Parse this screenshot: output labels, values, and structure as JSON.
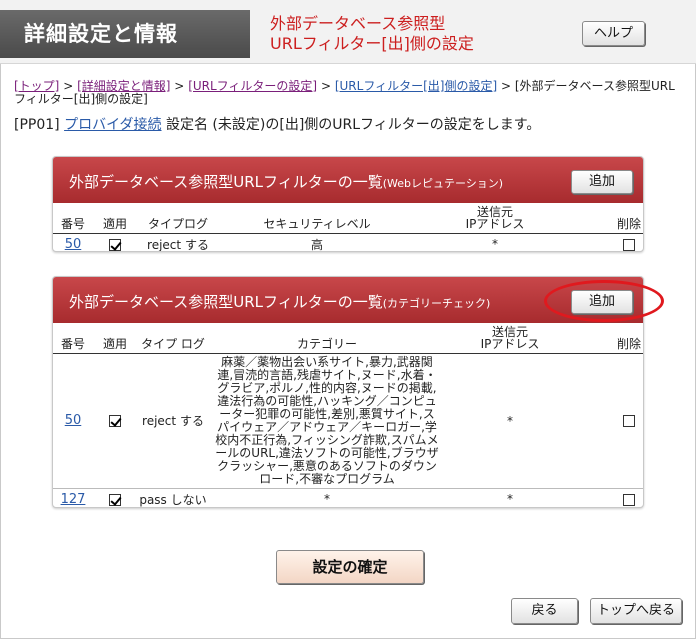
{
  "header": {
    "title": "詳細設定と情報",
    "subtitle_line1": "外部データベース参照型",
    "subtitle_line2": "URLフィルター[出]側の設定",
    "help_label": "ヘルプ"
  },
  "breadcrumb": {
    "items": [
      "[トップ]",
      "[詳細設定と情報]",
      "[URLフィルターの設定]",
      "[URLフィルター[出]側の設定]"
    ],
    "separator": ">",
    "current": "[外部データベース参照型URLフィルター[出]側の設定]"
  },
  "intro": {
    "prefix": "[PP01]",
    "provider_link": "プロバイダ接続",
    "text": "設定名 (未設定)の[出]側のURLフィルターの設定をします。"
  },
  "panel1": {
    "title_main": "外部データベース参照型URLフィルターの一覧",
    "title_small": "(Webレピュテーション)",
    "add_label": "追加",
    "columns": [
      "番号",
      "適用",
      "タイプ",
      "ログ",
      "セキュリティレベル",
      "送信元",
      "IPアドレス",
      "削除"
    ],
    "rows": [
      {
        "number": "50",
        "applied": true,
        "type": "reject",
        "log": "する",
        "level": "高",
        "ip": "*",
        "delete": false
      }
    ]
  },
  "panel2": {
    "title_main": "外部データベース参照型URLフィルターの一覧",
    "title_small": "(カテゴリーチェック)",
    "add_label": "追加",
    "columns": [
      "番号",
      "適用",
      "タイプ",
      "ログ",
      "カテゴリー",
      "送信元",
      "IPアドレス",
      "削除"
    ],
    "rows": [
      {
        "number": "50",
        "applied": true,
        "type": "reject",
        "log": "する",
        "category": "麻薬／薬物出会い系サイト,暴力,武器関連,冒涜的言語,残虐サイト,ヌード,水着・グラビア,ポルノ,性的内容,ヌードの掲載,違法行為の可能性,ハッキング／コンピューター犯罪の可能性,差別,悪質サイト,スパイウェア／アドウェア／キーロガー,学校内不正行為,フィッシング詐欺,スパムメールのURL,違法ソフトの可能性,ブラウザクラッシャー,悪意のあるソフトのダウンロード,不審なプログラム",
        "ip": "*",
        "delete": false
      },
      {
        "number": "127",
        "applied": true,
        "type": "pass",
        "log": "しない",
        "category": "*",
        "ip": "*",
        "delete": false
      }
    ]
  },
  "footer": {
    "confirm_label": "設定の確定",
    "back_label": "戻る",
    "top_label": "トップへ戻る"
  },
  "colors": {
    "panel_header": "#b8383b",
    "subtitle": "#cc1f1f",
    "annotation_ring": "#e0191e"
  }
}
